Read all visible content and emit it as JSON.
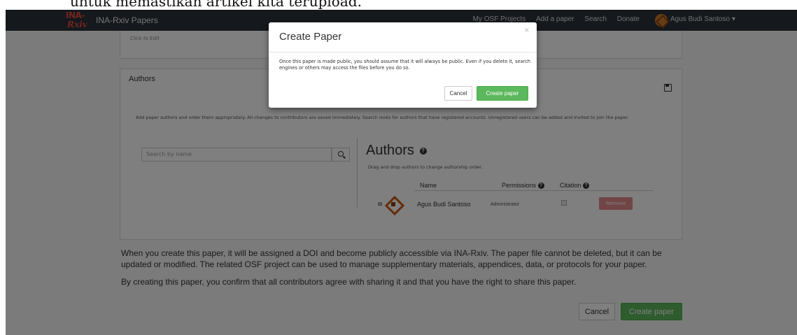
{
  "caption_fragment": "untuk memastikan artikel kita terupload.",
  "navbar": {
    "logo_top": "INA-",
    "logo_bottom": "Rxiv",
    "brand": "INA-Rxiv Papers",
    "links": [
      "My OSF Projects",
      "Add a paper",
      "Search",
      "Donate"
    ],
    "user": "Agus Budi Santoso ▾"
  },
  "top_panel": {
    "click_to_edit": "Click to Edit"
  },
  "authors_panel": {
    "heading": "Authors",
    "help_text": "Add paper authors and order them appropriately. All changes to contributors are saved immediately. Search looks for authors that have registered accounts. Unregistered users can be added and invited to join the paper.",
    "search_placeholder": "Search by name",
    "authors_title": "Authors",
    "drag_note": "Drag and drop authors to change authorship order.",
    "columns": {
      "name": "Name",
      "permissions": "Permissions",
      "citation": "Citation"
    },
    "row": {
      "drag": "≡",
      "name": "Agus Budi Santoso",
      "permission": "Administrator",
      "remove_label": "Remove"
    }
  },
  "info": {
    "paragraph1": "When you create this paper, it will be assigned a DOI and become publicly accessible via INA-Rxiv. The paper file cannot be deleted, but it can be updated or modified. The related OSF project can be used to manage supplementary materials, appendices, data, or protocols for your paper.",
    "paragraph2": "By creating this paper, you confirm that all contributors agree with sharing it and that you have the right to share this paper."
  },
  "footer_buttons": {
    "cancel": "Cancel",
    "create": "Create paper"
  },
  "modal": {
    "title": "Create Paper",
    "close": "×",
    "body": "Once this paper is made public, you should assume that it will always be public. Even if you delete it, search engines or others may access the files before you do so.",
    "cancel": "Cancel",
    "create": "Create paper"
  },
  "colors": {
    "navbar": "#2a3039",
    "accent_green": "#5cb85c",
    "remove_red": "#e38a8a",
    "logo_red": "#e64b3c"
  }
}
